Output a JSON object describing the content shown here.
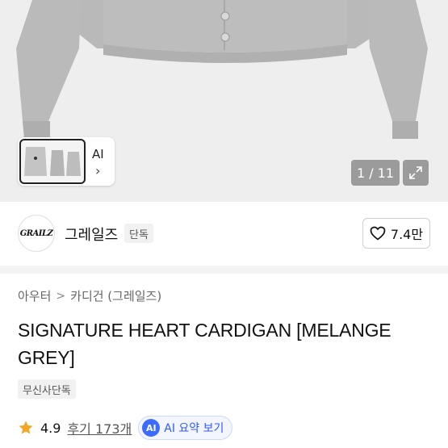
{
  "gallery": {
    "thumb_label": "AI",
    "thumb_chevron": "›",
    "counter": "1 / 11",
    "expand_icon": "expand-icon"
  },
  "brand": {
    "logo_text": "GRAILZ",
    "name": "그레일즈",
    "badge": "단독",
    "likes": "7.4만"
  },
  "breadcrumb": {
    "items": [
      "아우터",
      "카디건 (그레일즈)"
    ],
    "separator": ">"
  },
  "product": {
    "title": "SIGNATURE HEART CARDIGAN [MELANGE GREY]",
    "exclusive_badge": "무신사단독"
  },
  "rating": {
    "score": "4.9",
    "reviews": "후기 173개",
    "ai_chip": "AI 요약 보기",
    "ai_mark": "AI"
  },
  "colors": {
    "star": "#f5a623",
    "ai_accent": "#3b6cff"
  }
}
